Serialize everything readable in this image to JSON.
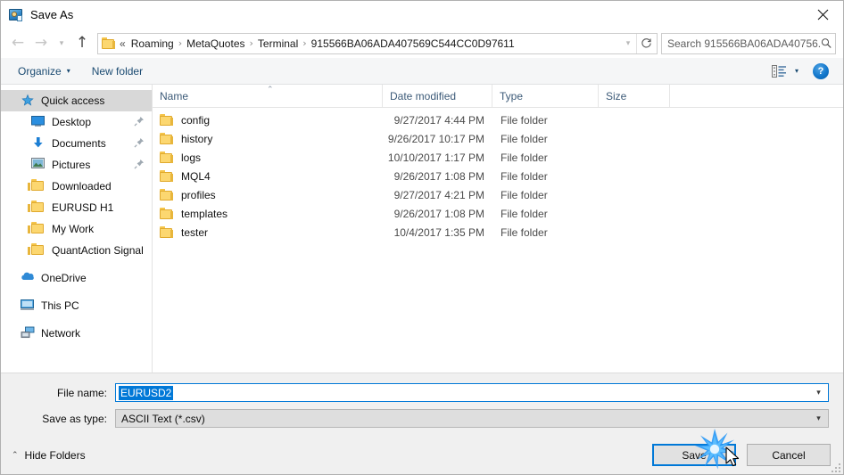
{
  "window": {
    "title": "Save As",
    "icon": "save-as-app-icon",
    "close_label": "✕"
  },
  "nav": {
    "back_icon": "arrow-left-icon",
    "forward_icon": "arrow-right-icon",
    "recent_icon": "chevron-down-icon",
    "up_icon": "arrow-up-icon",
    "breadcrumb_prefix": "«",
    "crumbs": [
      "Roaming",
      "MetaQuotes",
      "Terminal",
      "915566BA06ADA407569C544CC0D97611"
    ],
    "separator": "›",
    "dropdown_icon": "chevron-down-icon",
    "refresh_icon": "refresh-icon"
  },
  "search": {
    "placeholder": "Search 915566BA06ADA40756...",
    "icon": "search-icon"
  },
  "toolbar": {
    "organize_label": "Organize",
    "organize_caret": "▾",
    "new_folder_label": "New folder",
    "view_icon": "view-layout-icon",
    "view_caret": "▾",
    "help_label": "?"
  },
  "sidebar": {
    "items": [
      {
        "label": "Quick access",
        "icon": "star-pin-icon",
        "level": 0,
        "selected": true,
        "pinned": false
      },
      {
        "label": "Desktop",
        "icon": "desktop-icon",
        "level": 1,
        "selected": false,
        "pinned": true
      },
      {
        "label": "Documents",
        "icon": "documents-download-icon",
        "level": 1,
        "selected": false,
        "pinned": true
      },
      {
        "label": "Pictures",
        "icon": "pictures-icon",
        "level": 1,
        "selected": false,
        "pinned": true
      },
      {
        "label": "Downloaded",
        "icon": "folder-icon",
        "level": 1,
        "selected": false,
        "pinned": false
      },
      {
        "label": "EURUSD H1",
        "icon": "folder-icon",
        "level": 1,
        "selected": false,
        "pinned": false
      },
      {
        "label": "My Work",
        "icon": "folder-icon",
        "level": 1,
        "selected": false,
        "pinned": false
      },
      {
        "label": "QuantAction Signal",
        "icon": "folder-icon",
        "level": 1,
        "selected": false,
        "pinned": false
      },
      {
        "label": "OneDrive",
        "icon": "onedrive-cloud-icon",
        "level": 0,
        "selected": false,
        "pinned": false,
        "gap_before": true
      },
      {
        "label": "This PC",
        "icon": "this-pc-icon",
        "level": 0,
        "selected": false,
        "pinned": false,
        "gap_before": true
      },
      {
        "label": "Network",
        "icon": "network-icon",
        "level": 0,
        "selected": false,
        "pinned": false,
        "gap_before": true
      }
    ]
  },
  "filelist": {
    "columns": [
      {
        "label": "Name",
        "sorted": "asc",
        "sort_caret": "⌃"
      },
      {
        "label": "Date modified",
        "sorted": ""
      },
      {
        "label": "Type",
        "sorted": ""
      },
      {
        "label": "Size",
        "sorted": ""
      }
    ],
    "rows": [
      {
        "name": "config",
        "date": "9/27/2017 4:44 PM",
        "type": "File folder",
        "size": "",
        "icon": "folder-icon"
      },
      {
        "name": "history",
        "date": "9/26/2017 10:17 PM",
        "type": "File folder",
        "size": "",
        "icon": "folder-icon"
      },
      {
        "name": "logs",
        "date": "10/10/2017 1:17 PM",
        "type": "File folder",
        "size": "",
        "icon": "folder-icon"
      },
      {
        "name": "MQL4",
        "date": "9/26/2017 1:08 PM",
        "type": "File folder",
        "size": "",
        "icon": "folder-icon"
      },
      {
        "name": "profiles",
        "date": "9/27/2017 4:21 PM",
        "type": "File folder",
        "size": "",
        "icon": "folder-icon"
      },
      {
        "name": "templates",
        "date": "9/26/2017 1:08 PM",
        "type": "File folder",
        "size": "",
        "icon": "folder-icon"
      },
      {
        "name": "tester",
        "date": "10/4/2017 1:35 PM",
        "type": "File folder",
        "size": "",
        "icon": "folder-icon"
      }
    ]
  },
  "form": {
    "filename_label": "File name:",
    "filename_value": "EURUSD2",
    "filetype_label": "Save as type:",
    "filetype_value": "ASCII Text (*.csv)",
    "dropdown_icon": "chevron-down-icon"
  },
  "footer": {
    "hide_folders_label": "Hide Folders",
    "hide_folders_caret": "⌃",
    "save_label": "Save",
    "cancel_label": "Cancel",
    "resize_grip_icon": "resize-grip-icon"
  },
  "overlay": {
    "click_burst_icon": "click-burst-icon",
    "cursor_icon": "mouse-pointer-icon",
    "accent_color": "#0078d7",
    "burst_color": "#1f8ef1"
  }
}
